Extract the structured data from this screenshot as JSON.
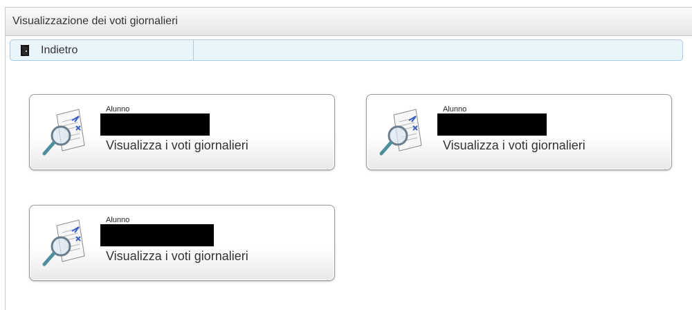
{
  "panel": {
    "title": "Visualizzazione dei voti giornalieri"
  },
  "toolbar": {
    "back_label": "Indietro",
    "back_icon": "exit-door-icon"
  },
  "cards": [
    {
      "caption": "Alunno",
      "name": "",
      "name_redacted": true,
      "action": "Visualizza i voti giornalieri",
      "icon": "magnifier-document-icon"
    },
    {
      "caption": "Alunno",
      "name": "",
      "name_redacted": true,
      "action": "Visualizza i voti giornalieri",
      "icon": "magnifier-document-icon"
    },
    {
      "caption": "Alunno",
      "name": "",
      "name_redacted": true,
      "action": "Visualizza i voti giornalieri",
      "icon": "magnifier-document-icon"
    }
  ],
  "colors": {
    "toolbar_bg": "#eaf4fb",
    "toolbar_border": "#a9cbe6",
    "redaction": "#000000"
  }
}
